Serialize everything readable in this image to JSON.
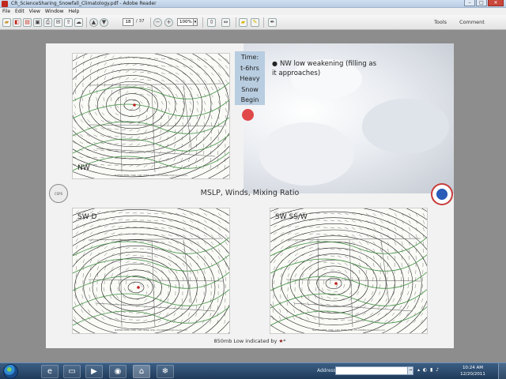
{
  "window": {
    "title": "CR_ScienceSharing_Snowfall_Climatology.pdf - Adobe Reader",
    "minimize": "–",
    "maximize": "□",
    "close": "✕"
  },
  "menu": [
    "File",
    "Edit",
    "View",
    "Window",
    "Help"
  ],
  "toolbar": {
    "current_page": "18",
    "total_pages": "/ 37",
    "zoom": "100%",
    "tools_label": "Tools",
    "comment_label": "Comment"
  },
  "slide": {
    "time_box": [
      "Time:",
      "t-6hrs",
      "Heavy",
      "Snow",
      "Begin"
    ],
    "bullet": "NW low weakening (filling as it approaches)",
    "maps": [
      {
        "label": "NW"
      },
      {
        "label": "SW D"
      },
      {
        "label": "SW SS/W"
      }
    ],
    "map_caption": "NAEMM PMSL (hPa), 10m WIND (kts), 2m MIXING high Cus/m-n/m",
    "middle_label": "MSLP, Winds, Mixing Ratio",
    "footer_text": "850mb Low indicated by",
    "footer_star": "★",
    "footer_tail": "*",
    "logo_left": "CSPS"
  },
  "taskbar": {
    "address_label": "Address",
    "time": "10:24 AM",
    "date": "12/20/2011"
  },
  "colors": {
    "time_box": "#b8cde0",
    "red_dot": "#e0484a",
    "taskbar": "#1f3a5b"
  }
}
